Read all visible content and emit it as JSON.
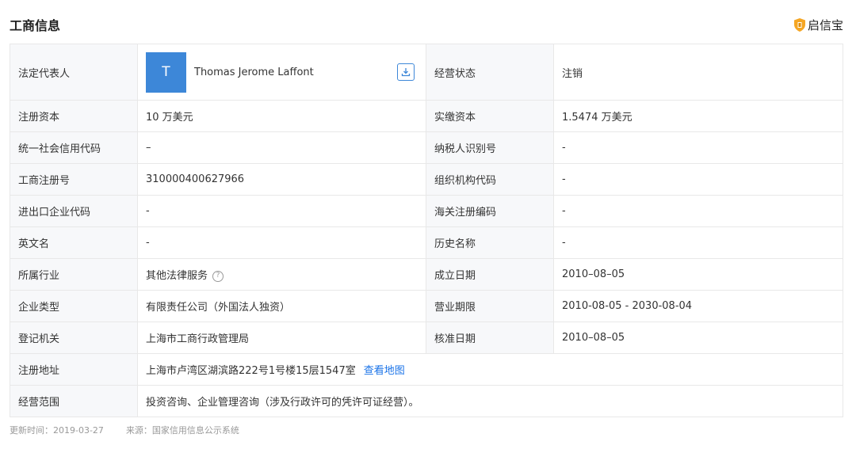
{
  "header": {
    "title": "工商信息",
    "brand": "启信宝",
    "brand_color": "#f5a623"
  },
  "representative": {
    "label": "法定代表人",
    "avatar_letter": "T",
    "name": "Thomas Jerome Laffont",
    "status_label": "经营状态",
    "status_value": "注销"
  },
  "rows": [
    {
      "l1": "注册资本",
      "v1": "10 万美元",
      "l2": "实缴资本",
      "v2": "1.5474 万美元"
    },
    {
      "l1": "统一社会信用代码",
      "v1": "–",
      "l2": "纳税人识别号",
      "v2": "-"
    },
    {
      "l1": "工商注册号",
      "v1": "310000400627966",
      "l2": "组织机构代码",
      "v2": "-"
    },
    {
      "l1": "进出口企业代码",
      "v1": "-",
      "l2": "海关注册编码",
      "v2": "-"
    },
    {
      "l1": "英文名",
      "v1": "-",
      "l2": "历史名称",
      "v2": "-"
    },
    {
      "l1": "所属行业",
      "v1": "其他法律服务",
      "l2": "成立日期",
      "v2": "2010–08–05"
    },
    {
      "l1": "企业类型",
      "v1": "有限责任公司（外国法人独资）",
      "l2": "营业期限",
      "v2": "2010-08-05 - 2030-08-04"
    },
    {
      "l1": "登记机关",
      "v1": "上海市工商行政管理局",
      "l2": "核准日期",
      "v2": "2010–08–05"
    }
  ],
  "address": {
    "label": "注册地址",
    "value": "上海市卢湾区湖滨路222号1号楼15层1547室",
    "map_link": "查看地图"
  },
  "scope": {
    "label": "经营范围",
    "value": "投资咨询、企业管理咨询（涉及行政许可的凭许可证经营）。"
  },
  "footer": {
    "updated": "更新时间：2019-03-27",
    "source": "来源：国家信用信息公示系统"
  }
}
